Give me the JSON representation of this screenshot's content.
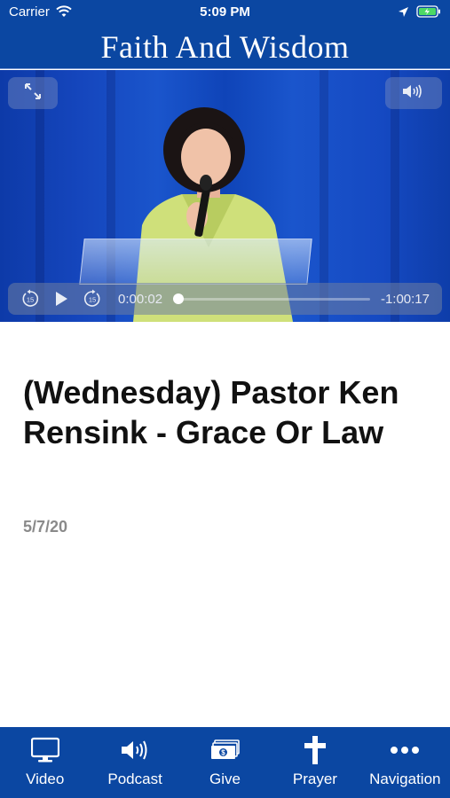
{
  "status_bar": {
    "carrier": "Carrier",
    "time": "5:09 PM"
  },
  "header": {
    "title": "Faith And Wisdom"
  },
  "player": {
    "current_time": "0:00:02",
    "remaining_time": "-1:00:17",
    "progress": 0.0,
    "skip_back_seconds": "15",
    "skip_forward_seconds": "15"
  },
  "episode": {
    "title": "(Wednesday) Pastor Ken Rensink - Grace Or Law",
    "date": "5/7/20"
  },
  "tabs": [
    {
      "label": "Video",
      "icon": "monitor-icon"
    },
    {
      "label": "Podcast",
      "icon": "speaker-icon"
    },
    {
      "label": "Give",
      "icon": "money-icon"
    },
    {
      "label": "Prayer",
      "icon": "cross-icon"
    },
    {
      "label": "Navigation",
      "icon": "more-dots-icon"
    }
  ],
  "colors": {
    "brand_blue": "#0b47a2",
    "date_gray": "#8a8a8a"
  }
}
